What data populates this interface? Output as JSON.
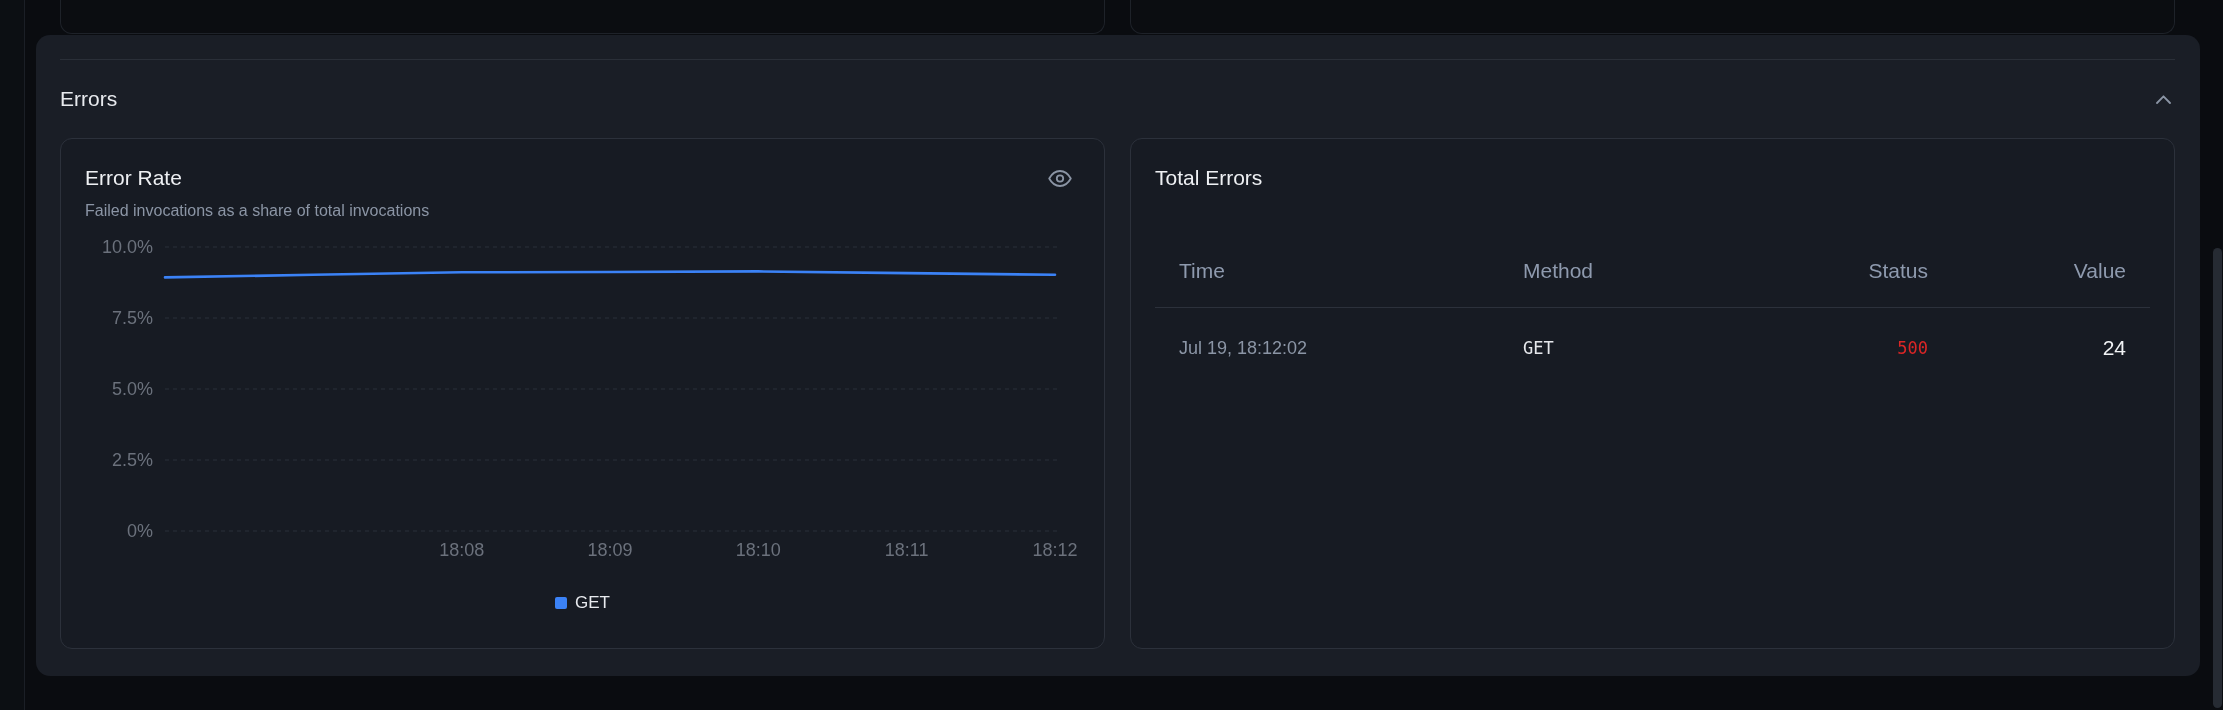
{
  "section": {
    "title": "Errors",
    "expanded": true
  },
  "error_rate": {
    "title": "Error Rate",
    "subtitle": "Failed invocations as a share of total invocations",
    "chart_data": {
      "type": "line",
      "categories": [
        null,
        null,
        "18:08",
        "18:09",
        "18:10",
        "18:11",
        "18:12"
      ],
      "series": [
        {
          "name": "GET",
          "color": "#3b82f6",
          "values": [
            8.93,
            9.02,
            9.11,
            9.12,
            9.14,
            9.08,
            9.02
          ]
        }
      ],
      "ylim": [
        0,
        10
      ],
      "yticks": [
        {
          "value": 10,
          "label": "10.0%"
        },
        {
          "value": 7.5,
          "label": "7.5%"
        },
        {
          "value": 5,
          "label": "5.0%"
        },
        {
          "value": 2.5,
          "label": "2.5%"
        },
        {
          "value": 0,
          "label": "0%"
        }
      ],
      "grid": true
    }
  },
  "total_errors": {
    "title": "Total Errors",
    "table": {
      "columns": [
        "Time",
        "Method",
        "Status",
        "Value"
      ],
      "rows": [
        {
          "time": "Jul 19, 18:12:02",
          "method": "GET",
          "status": "500",
          "color": "#dc2626",
          "value": "24"
        }
      ]
    }
  }
}
